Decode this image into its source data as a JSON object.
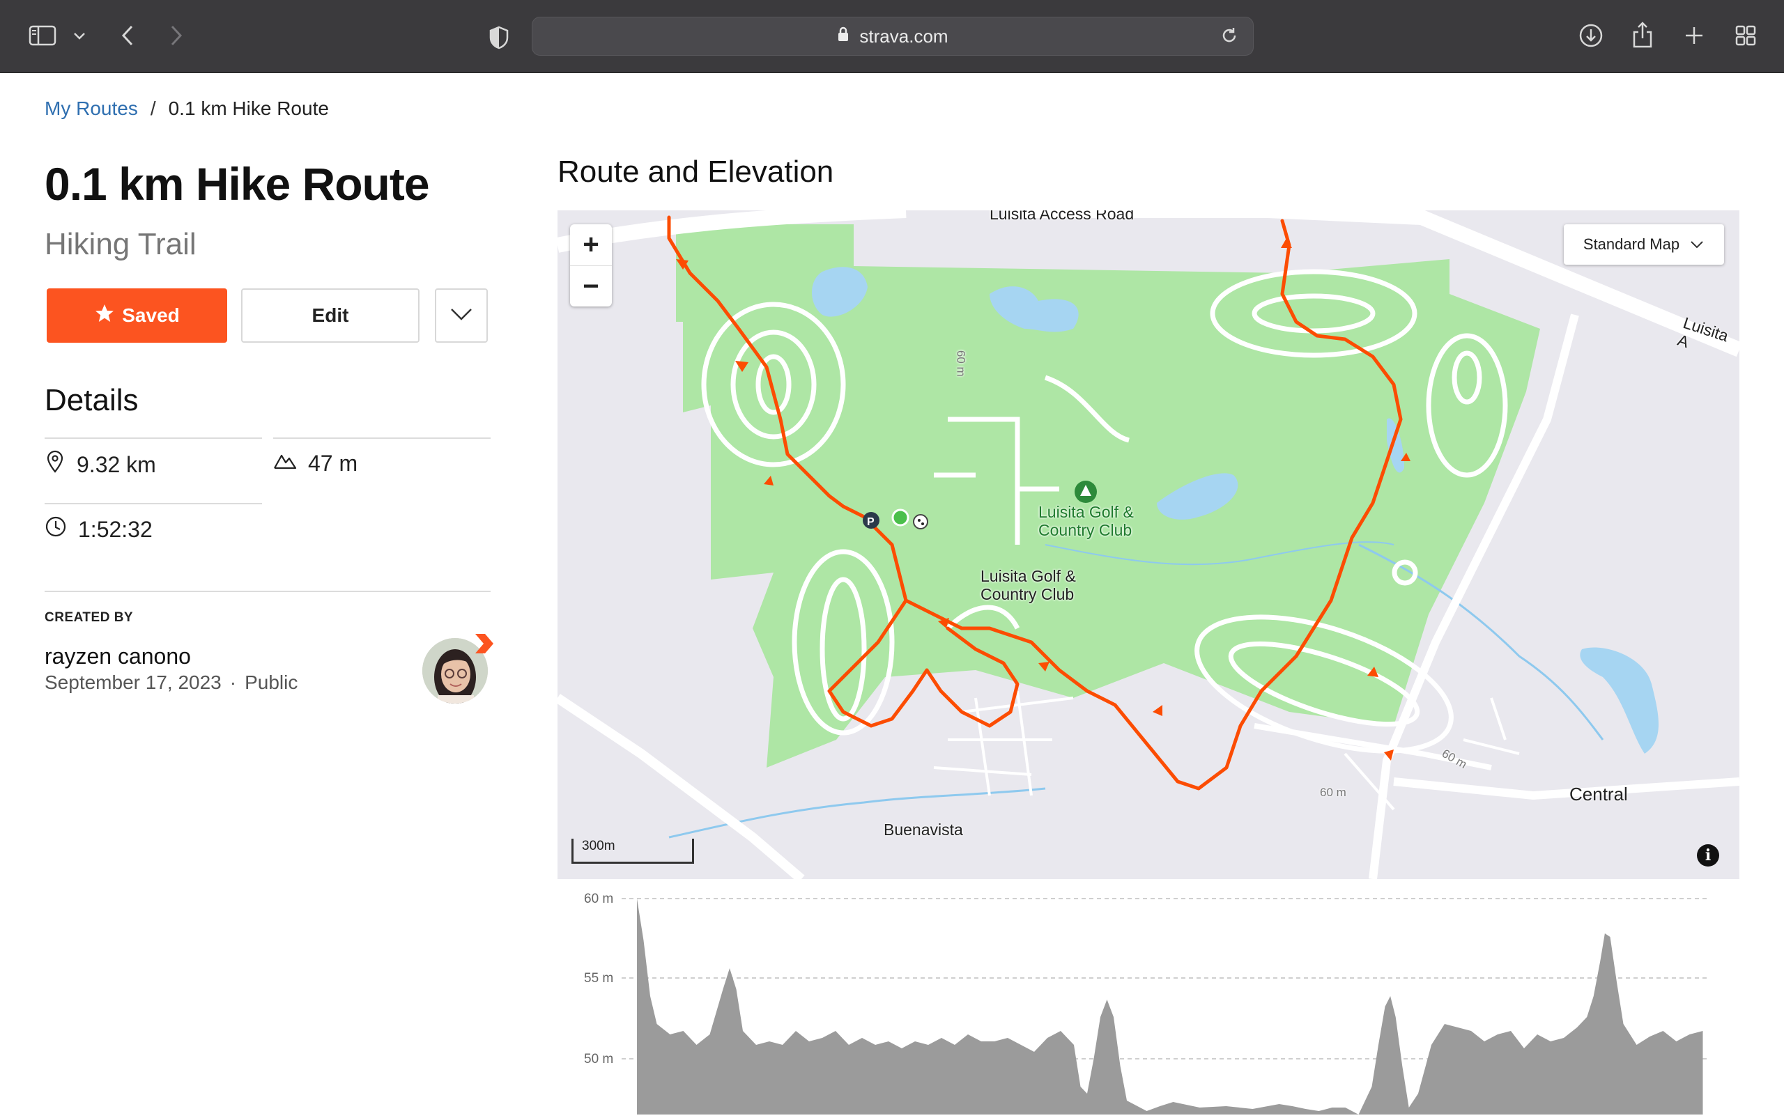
{
  "browser": {
    "url": "strava.com"
  },
  "breadcrumb": {
    "parent": "My Routes",
    "separator": "/",
    "current": "0.1 km Hike Route"
  },
  "route": {
    "title": "0.1 km Hike Route",
    "type": "Hiking Trail",
    "saved_label": "Saved",
    "edit_label": "Edit"
  },
  "details": {
    "heading": "Details",
    "distance": "9.32 km",
    "elevation_gain": "47 m",
    "time": "1:52:32"
  },
  "creator": {
    "heading": "CREATED BY",
    "name": "rayzen canono",
    "date": "September 17, 2023",
    "dot": "·",
    "visibility": "Public"
  },
  "map": {
    "heading": "Route and Elevation",
    "map_type": "Standard Map",
    "scale": "300m",
    "labels": {
      "luisita_access": "Luisita Access Road",
      "luisita_road": "Luisita A",
      "golf_club_poi_line1": "Luisita Golf &",
      "golf_club_poi_line2": "Country Club",
      "golf_club_line1": "Luisita Golf &",
      "golf_club_line2": "Country Club",
      "buenavista": "Buenavista",
      "central": "Central",
      "contour_60_a": "60 m",
      "contour_60_b": "60 m",
      "contour_60_c": "60 m"
    },
    "colors": {
      "route": "#fc4c02",
      "park": "#aee6a5",
      "water": "#a6d5f2",
      "land": "#e9e8ee"
    }
  },
  "elevation": {
    "y_labels": [
      "60 m",
      "55 m",
      "50 m"
    ],
    "fill": "#9b9b9b"
  }
}
